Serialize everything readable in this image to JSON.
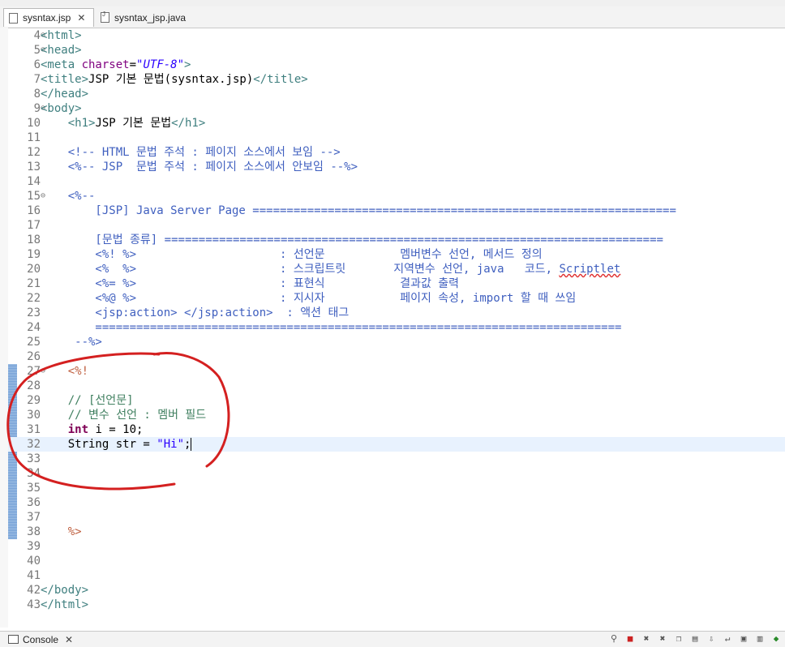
{
  "editor_tabs": [
    {
      "label": "sysntax.jsp",
      "active": true
    },
    {
      "label": "sysntax_jsp.java",
      "active": false
    }
  ],
  "code_lines": [
    {
      "num": "4",
      "fold": "⊖",
      "parts": [
        [
          "tag",
          "<html>"
        ]
      ]
    },
    {
      "num": "5",
      "fold": "⊖",
      "parts": [
        [
          "tag",
          "<head>"
        ]
      ]
    },
    {
      "num": "6",
      "fold": "",
      "parts": [
        [
          "tag",
          "<meta "
        ],
        [
          "attr",
          "charset"
        ],
        [
          "txt",
          "="
        ],
        [
          "str",
          "\"UTF-8\""
        ],
        [
          "tag",
          ">"
        ]
      ]
    },
    {
      "num": "7",
      "fold": "",
      "parts": [
        [
          "tag",
          "<title>"
        ],
        [
          "txt",
          "JSP 기본 문법(sysntax.jsp)"
        ],
        [
          "tag",
          "</title>"
        ]
      ]
    },
    {
      "num": "8",
      "fold": "",
      "parts": [
        [
          "tag",
          "</head>"
        ]
      ]
    },
    {
      "num": "9",
      "fold": "⊖",
      "parts": [
        [
          "tag",
          "<body>"
        ]
      ]
    },
    {
      "num": "10",
      "fold": "",
      "parts": [
        [
          "txt",
          "    "
        ],
        [
          "tag",
          "<h1>"
        ],
        [
          "txt",
          "JSP 기본 문법"
        ],
        [
          "tag",
          "</h1>"
        ]
      ]
    },
    {
      "num": "11",
      "fold": "",
      "parts": []
    },
    {
      "num": "12",
      "fold": "",
      "parts": [
        [
          "txt",
          "    "
        ],
        [
          "cmt",
          "<!-- HTML 문법 주석 : 페이지 소스에서 보임 -->"
        ]
      ]
    },
    {
      "num": "13",
      "fold": "",
      "parts": [
        [
          "txt",
          "    "
        ],
        [
          "jspc",
          "<%-- JSP  문법 주석 : 페이지 소스에서 안보임 --%>"
        ]
      ]
    },
    {
      "num": "14",
      "fold": "",
      "parts": []
    },
    {
      "num": "15",
      "fold": "⊖",
      "parts": [
        [
          "txt",
          "    "
        ],
        [
          "jspc",
          "<%--"
        ]
      ]
    },
    {
      "num": "16",
      "fold": "",
      "parts": [
        [
          "jspc",
          "        [JSP] Java Server Page =============================================================="
        ]
      ]
    },
    {
      "num": "17",
      "fold": "",
      "parts": []
    },
    {
      "num": "18",
      "fold": "",
      "parts": [
        [
          "jspc",
          "        [문법 종류] ========================================================================="
        ]
      ]
    },
    {
      "num": "19",
      "fold": "",
      "parts": [
        [
          "jspc",
          "        <%! %>                     : 선언문           멤버변수 선언, 메서드 정의"
        ]
      ]
    },
    {
      "num": "20",
      "fold": "",
      "parts": [
        [
          "jspc",
          "        <%  %>                     : 스크립트릿       지역변수 선언, java   코드, "
        ],
        [
          "squig",
          "Scriptlet"
        ]
      ]
    },
    {
      "num": "21",
      "fold": "",
      "parts": [
        [
          "jspc",
          "        <%= %>                     : 표현식           결과값 출력"
        ]
      ]
    },
    {
      "num": "22",
      "fold": "",
      "parts": [
        [
          "jspc",
          "        <%@ %>                     : 지시자           페이지 속성, import 할 때 쓰임"
        ]
      ]
    },
    {
      "num": "23",
      "fold": "",
      "parts": [
        [
          "jspc",
          "        <jsp:action> </jsp:action>  : 액션 태그"
        ]
      ]
    },
    {
      "num": "24",
      "fold": "",
      "parts": [
        [
          "jspc",
          "        ============================================================================="
        ]
      ]
    },
    {
      "num": "25",
      "fold": "",
      "parts": [
        [
          "jspc",
          "     --%>"
        ]
      ]
    },
    {
      "num": "26",
      "fold": "",
      "parts": []
    },
    {
      "num": "27",
      "fold": "⊖",
      "parts": [
        [
          "txt",
          "    "
        ],
        [
          "jspd",
          "<%!"
        ]
      ]
    },
    {
      "num": "28",
      "fold": "",
      "parts": []
    },
    {
      "num": "29",
      "fold": "",
      "parts": [
        [
          "jcmt",
          "    // [선언문]"
        ]
      ]
    },
    {
      "num": "30",
      "fold": "",
      "parts": [
        [
          "jcmt",
          "    // 변수 선언 : 멤버 필드"
        ]
      ]
    },
    {
      "num": "31",
      "fold": "",
      "parts": [
        [
          "txt",
          "    "
        ],
        [
          "kw",
          "int"
        ],
        [
          "txt",
          " i = 10;"
        ]
      ]
    },
    {
      "num": "32",
      "fold": "",
      "parts": [
        [
          "txt",
          "    String str = "
        ],
        [
          "jstr",
          "\"Hi\""
        ],
        [
          "txt",
          ";"
        ]
      ]
    },
    {
      "num": "33",
      "fold": "",
      "parts": []
    },
    {
      "num": "34",
      "fold": "",
      "parts": []
    },
    {
      "num": "35",
      "fold": "",
      "parts": []
    },
    {
      "num": "36",
      "fold": "",
      "parts": []
    },
    {
      "num": "37",
      "fold": "",
      "parts": []
    },
    {
      "num": "38",
      "fold": "",
      "parts": [
        [
          "txt",
          "    "
        ],
        [
          "jspd",
          "%>"
        ]
      ]
    },
    {
      "num": "39",
      "fold": "",
      "parts": []
    },
    {
      "num": "40",
      "fold": "",
      "parts": []
    },
    {
      "num": "41",
      "fold": "",
      "parts": []
    },
    {
      "num": "42",
      "fold": "",
      "parts": [
        [
          "tag",
          "</body>"
        ]
      ]
    },
    {
      "num": "43",
      "fold": "",
      "parts": [
        [
          "tag",
          "</html>"
        ]
      ]
    }
  ],
  "current_line": "32",
  "changed_lines": [
    "27",
    "38"
  ],
  "annotation_color": "#d42020",
  "bottom_panel": {
    "console_label": "Console"
  },
  "colors": {
    "tag": "#3f7f7f",
    "attribute": "#7f007f",
    "string": "#2a00ff",
    "comment": "#3f5fbf",
    "jsp_delimiter": "#bf5f3f",
    "java_comment": "#3f7f5f",
    "keyword": "#7f0055",
    "current_line_bg": "#e8f2fe"
  }
}
